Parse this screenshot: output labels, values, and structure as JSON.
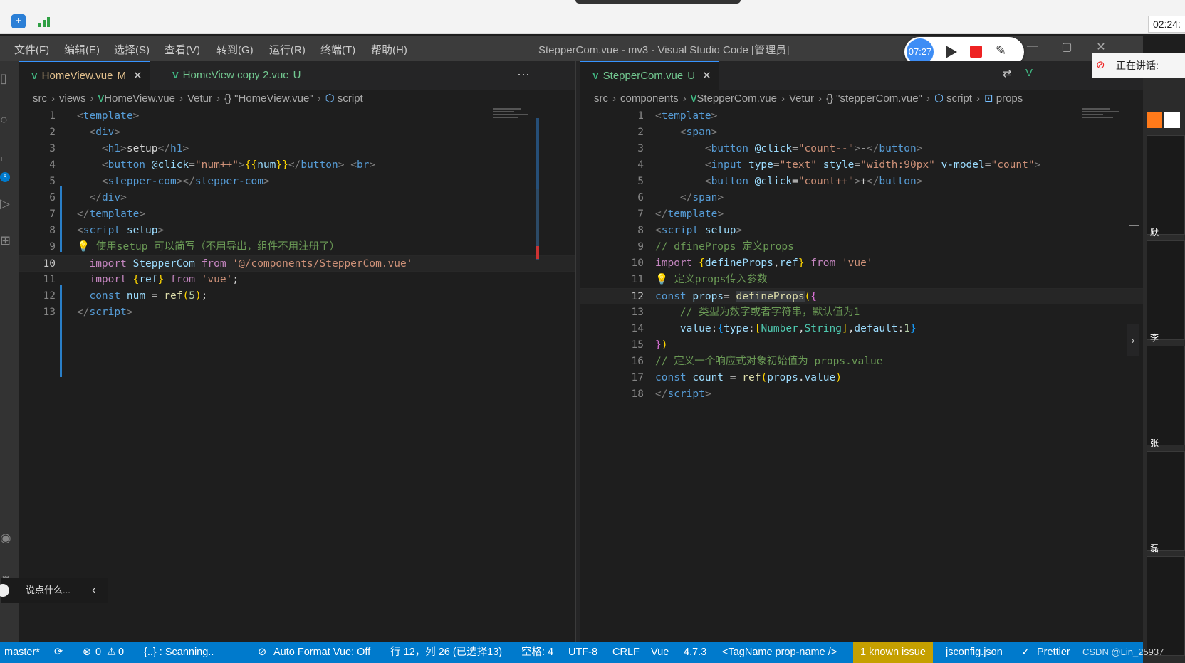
{
  "browser": {
    "clock": "02:24:"
  },
  "titlebar": {
    "menus": [
      "文件(F)",
      "编辑(E)",
      "选择(S)",
      "查看(V)",
      "转到(G)",
      "运行(R)",
      "终端(T)",
      "帮助(H)"
    ],
    "title": "StepperCom.vue - mv3 - Visual Studio Code [管理员]"
  },
  "recorder": {
    "time": "07:27"
  },
  "activity": {
    "scm_badge": "5"
  },
  "left_editor": {
    "tabs": [
      {
        "label": "HomeView.vue",
        "status": "M"
      },
      {
        "label": "HomeView copy 2.vue",
        "status": "U"
      }
    ],
    "more": "···",
    "breadcrumb": [
      "src",
      "views",
      "HomeView.vue",
      "Vetur",
      "{} \"HomeView.vue\"",
      "script"
    ],
    "current_line": 10,
    "lines": [
      "1",
      "2",
      "3",
      "4",
      "5",
      "6",
      "7",
      "8",
      "9",
      "10",
      "11",
      "12",
      "13"
    ]
  },
  "right_editor": {
    "tabs": [
      {
        "label": "StepperCom.vue",
        "status": "U"
      }
    ],
    "breadcrumb": [
      "src",
      "components",
      "StepperCom.vue",
      "Vetur",
      "{} \"stepperCom.vue\"",
      "script",
      "props"
    ],
    "current_line": 12,
    "lines": [
      "1",
      "2",
      "3",
      "4",
      "5",
      "6",
      "7",
      "8",
      "9",
      "10",
      "11",
      "12",
      "13",
      "14",
      "15",
      "16",
      "17",
      "18"
    ]
  },
  "meeting": {
    "speaking_label": "正在讲话:",
    "participants": [
      "默",
      "李",
      "张",
      "磊"
    ]
  },
  "chat": {
    "placeholder": "说点什么..."
  },
  "statusbar": {
    "branch": "master*",
    "errors": "0",
    "warnings": "0",
    "scanning": "{..} : Scanning..",
    "auto_format": "Auto Format Vue: Off",
    "position": "行 12，列 26 (已选择13)",
    "spaces": "空格: 4",
    "encoding": "UTF-8",
    "eol": "CRLF",
    "language": "Vue",
    "version": "4.7.3",
    "tagname": "<TagName prop-name />",
    "issue": "1 known issue",
    "jsconfig": "jsconfig.json",
    "prettier": "Prettier",
    "watermark": "CSDN @Lin_25937"
  },
  "colors": {
    "accent": "#007acc",
    "editor_bg": "#1e1e1e",
    "vue_green": "#41b883"
  }
}
